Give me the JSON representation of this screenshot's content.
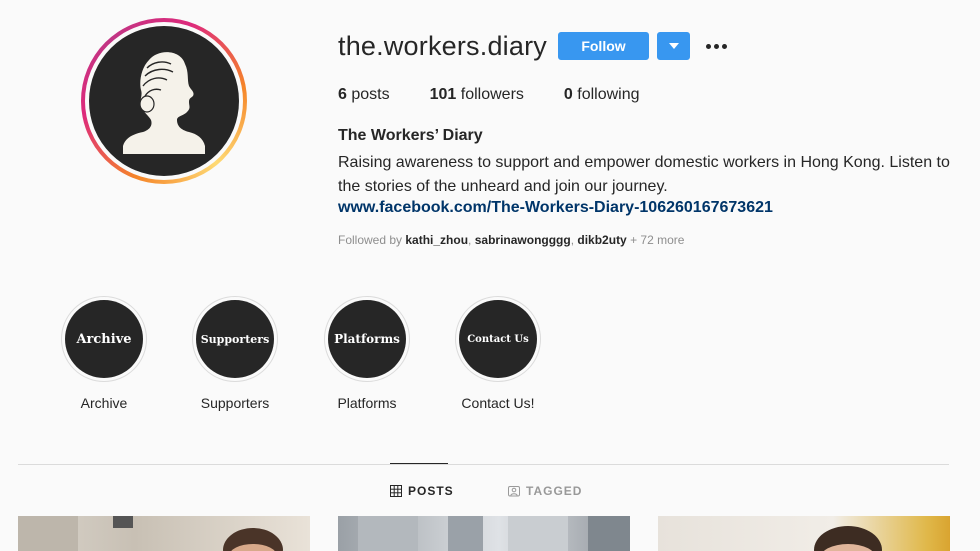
{
  "profile": {
    "username": "the.workers.diary",
    "follow_label": "Follow",
    "stats": {
      "posts_count": "6",
      "posts_label": "posts",
      "followers_count": "101",
      "followers_label": "followers",
      "following_count": "0",
      "following_label": "following"
    },
    "full_name": "The Workers’ Diary",
    "bio": "Raising awareness to support and empower domestic workers in Hong Kong. Listen to the stories of the unheard and join our journey.",
    "link": "www.facebook.com/The-Workers-Diary-106260167673621",
    "followed_by": {
      "prefix": "Followed by",
      "names": [
        "kathi_zhou",
        "sabrinawongggg",
        "dikb2uty"
      ],
      "more": "+ 72 more"
    },
    "icons": {
      "avatar": "woman-silhouette-icon",
      "dropdown": "caret-down-icon",
      "more": "more-horizontal-icon"
    }
  },
  "highlights": [
    {
      "cover_text": "Archive",
      "label": "Archive"
    },
    {
      "cover_text": "Supporters",
      "label": "Supporters"
    },
    {
      "cover_text": "Platforms",
      "label": "Platforms"
    },
    {
      "cover_text": "Contact Us",
      "label": "Contact Us!"
    }
  ],
  "tabs": [
    {
      "label": "POSTS",
      "icon": "grid-icon",
      "active": true
    },
    {
      "label": "TAGGED",
      "icon": "tag-person-icon",
      "active": false
    }
  ],
  "colors": {
    "accent": "#3897f0",
    "link": "#003569",
    "muted": "#8e8e8e"
  }
}
